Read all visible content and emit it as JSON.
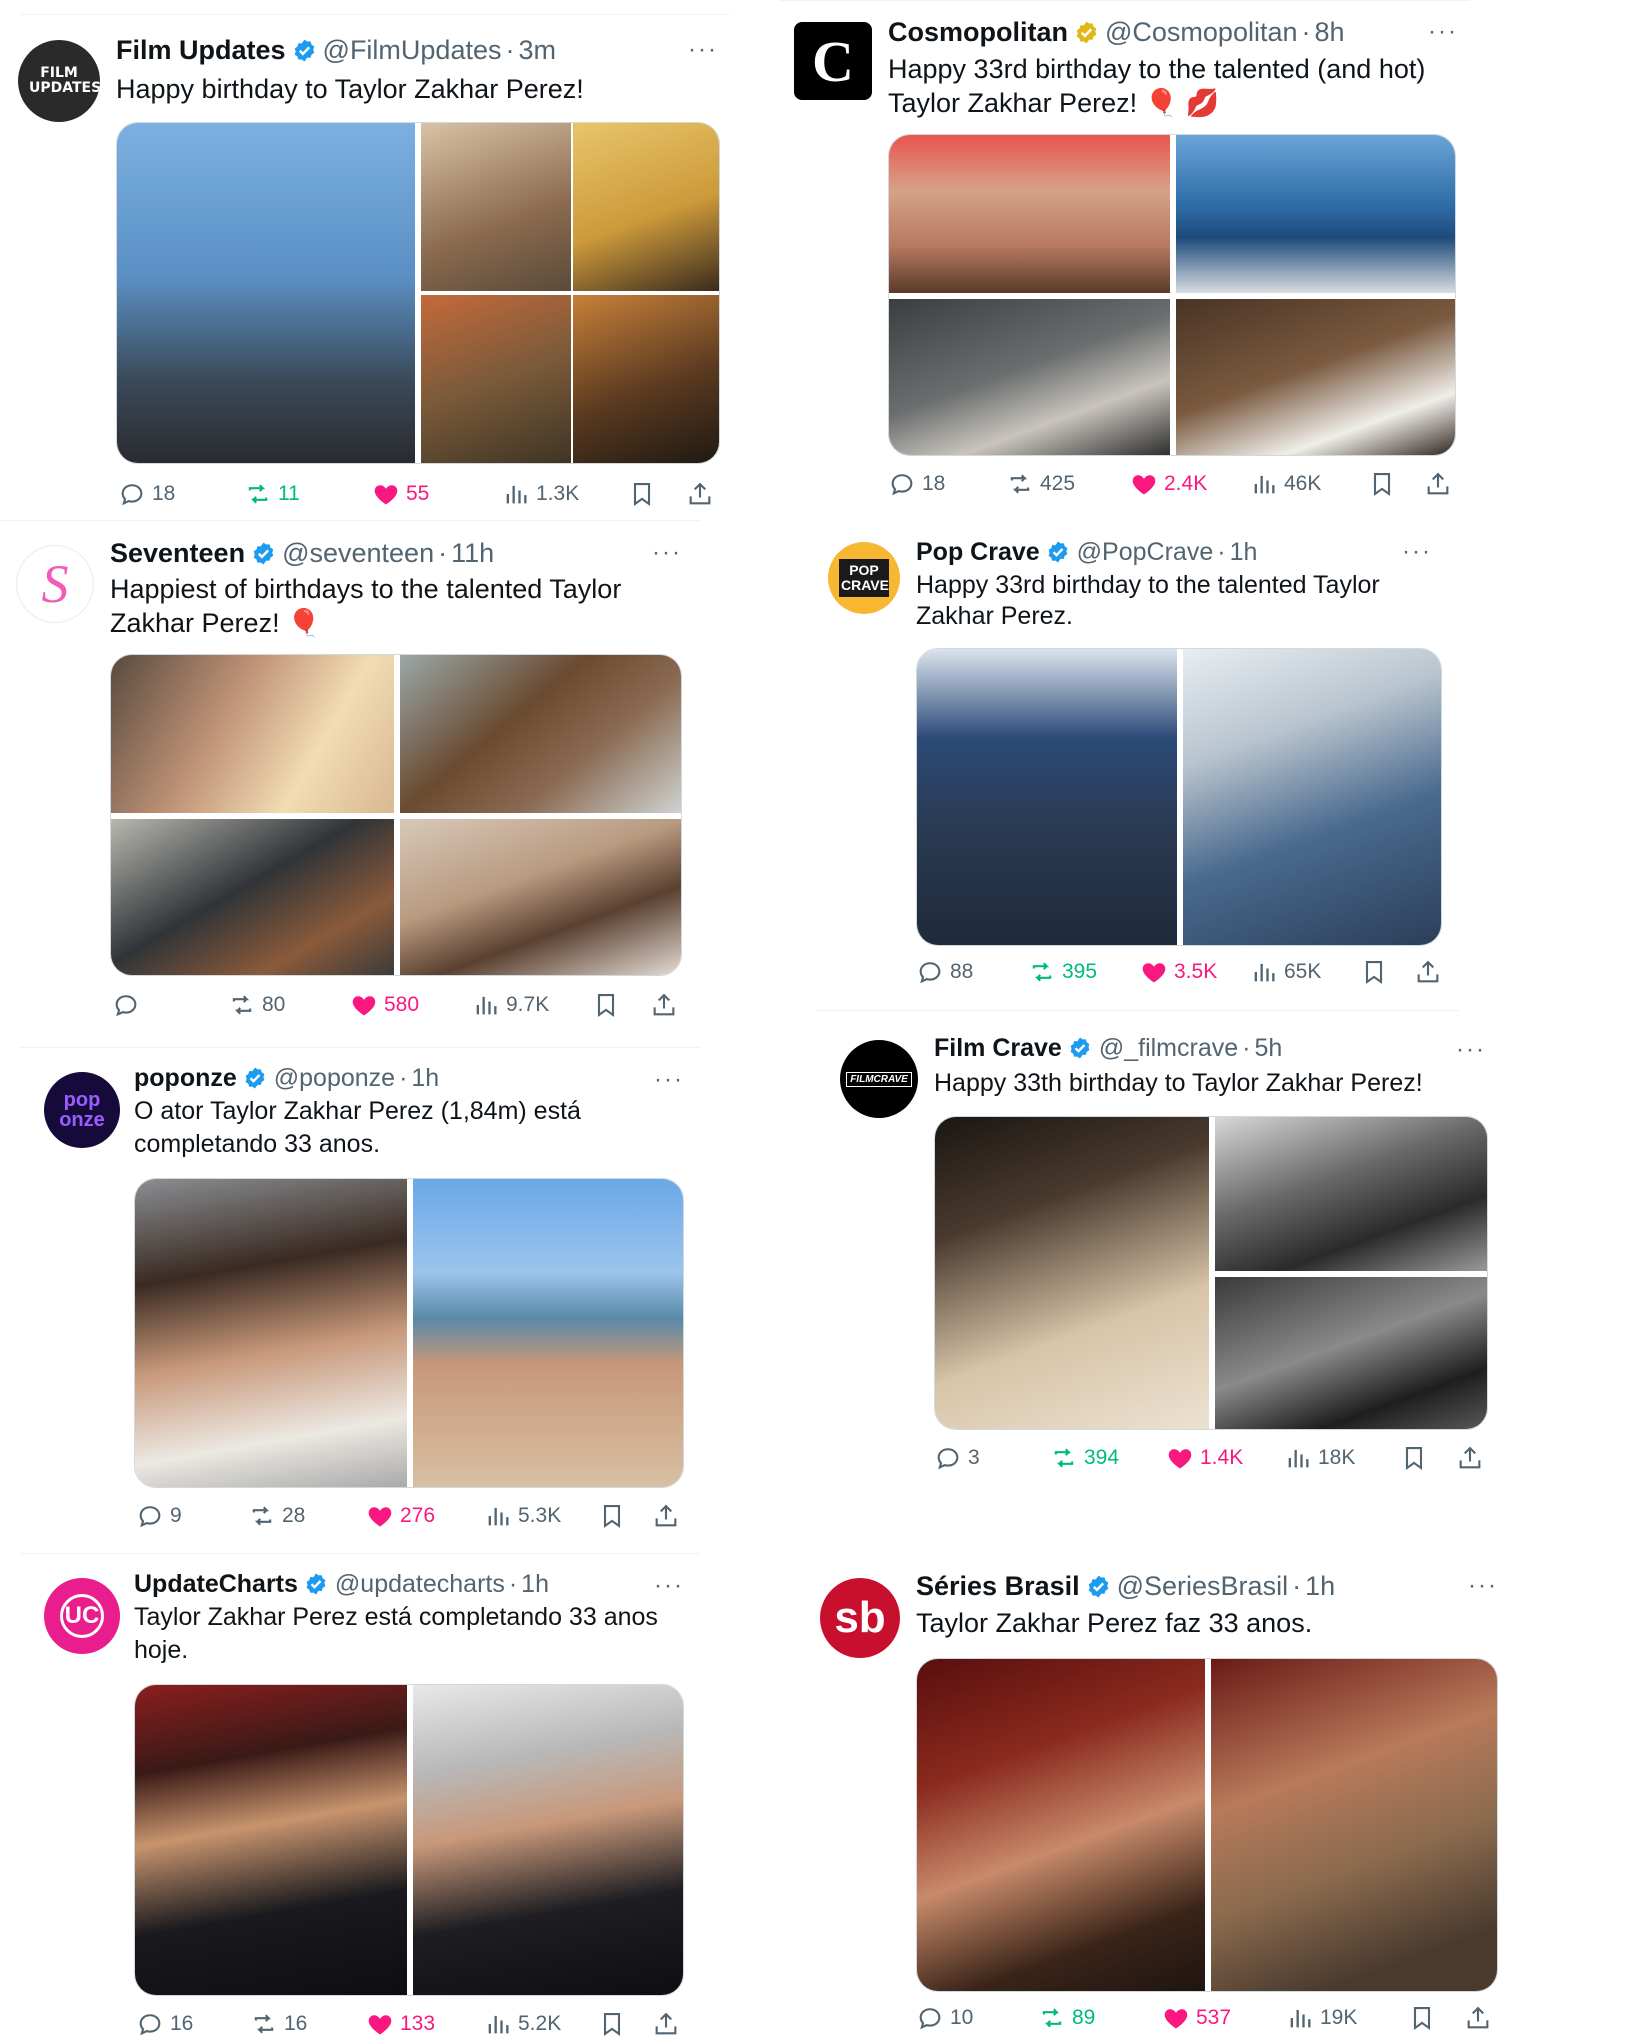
{
  "tweets": [
    {
      "id": "t1",
      "author": "Film Updates",
      "handle": "@FilmUpdates",
      "time": "3m",
      "text_lines": [
        "Happy birthday to Taylor Zakhar Perez!"
      ],
      "avatar_label": "FILM UPDATES",
      "badge": "blue",
      "stats": {
        "replies": "18",
        "reposts": "11",
        "likes": "55",
        "views": "1.3K"
      },
      "reposted": true
    },
    {
      "id": "t2",
      "author": "Cosmopolitan",
      "handle": "@Cosmopolitan",
      "time": "8h",
      "text_lines": [
        "Happy 33rd birthday to the talented (and hot)",
        "Taylor Zakhar Perez! 🎈 💋"
      ],
      "avatar_label": "C",
      "badge": "gold",
      "stats": {
        "replies": "18",
        "reposts": "425",
        "likes": "2.4K",
        "views": "46K"
      },
      "reposted": false
    },
    {
      "id": "t3",
      "author": "Seventeen",
      "handle": "@seventeen",
      "time": "11h",
      "text_lines": [
        "Happiest of birthdays to the talented Taylor",
        "Zakhar Perez! 🎈"
      ],
      "avatar_label": "S",
      "badge": "blue",
      "stats": {
        "replies": "",
        "reposts": "80",
        "likes": "580",
        "views": "9.7K"
      },
      "reposted": false
    },
    {
      "id": "t4",
      "author": "Pop Crave",
      "handle": "@PopCrave",
      "time": "1h",
      "text_lines": [
        "Happy 33rd birthday to the talented Taylor",
        "Zakhar Perez."
      ],
      "avatar_label": "POP CRAVE",
      "badge": "blue",
      "stats": {
        "replies": "88",
        "reposts": "395",
        "likes": "3.5K",
        "views": "65K"
      },
      "reposted": true
    },
    {
      "id": "t5",
      "author": "poponze",
      "handle": "@poponze",
      "time": "1h",
      "text_lines": [
        "O ator Taylor Zakhar Perez (1,84m) está",
        "completando 33 anos."
      ],
      "avatar_label": "pop onze",
      "badge": "blue",
      "stats": {
        "replies": "9",
        "reposts": "28",
        "likes": "276",
        "views": "5.3K"
      },
      "reposted": false
    },
    {
      "id": "t6",
      "author": "Film Crave",
      "handle": "@_filmcrave",
      "time": "5h",
      "text_lines": [
        "Happy 33th birthday to Taylor Zakhar Perez!"
      ],
      "avatar_label": "FILMCRAVE",
      "badge": "blue",
      "stats": {
        "replies": "3",
        "reposts": "394",
        "likes": "1.4K",
        "views": "18K"
      },
      "reposted": true
    },
    {
      "id": "t7",
      "author": "UpdateCharts",
      "handle": "@updatecharts",
      "time": "1h",
      "text_lines": [
        "Taylor Zakhar Perez está completando 33 anos",
        "hoje."
      ],
      "avatar_label": "UC",
      "badge": "blue",
      "stats": {
        "replies": "16",
        "reposts": "16",
        "likes": "133",
        "views": "5.2K"
      },
      "reposted": false
    },
    {
      "id": "t8",
      "author": "Séries Brasil",
      "handle": "@SeriesBrasil",
      "time": "1h",
      "text_lines": [
        "Taylor Zakhar Perez faz 33 anos."
      ],
      "avatar_label": "sb",
      "badge": "blue",
      "stats": {
        "replies": "10",
        "reposts": "89",
        "likes": "537",
        "views": "19K"
      },
      "reposted": true
    }
  ],
  "colors": {
    "accent_blue": "#1d9bf0",
    "gold": "#e2b719",
    "repost_green": "#00ba7c",
    "like_pink": "#f91880",
    "muted": "#536471"
  },
  "icons": [
    "reply-icon",
    "repost-icon",
    "like-icon",
    "views-icon",
    "bookmark-icon",
    "share-icon",
    "more-icon",
    "verified-badge-icon"
  ]
}
